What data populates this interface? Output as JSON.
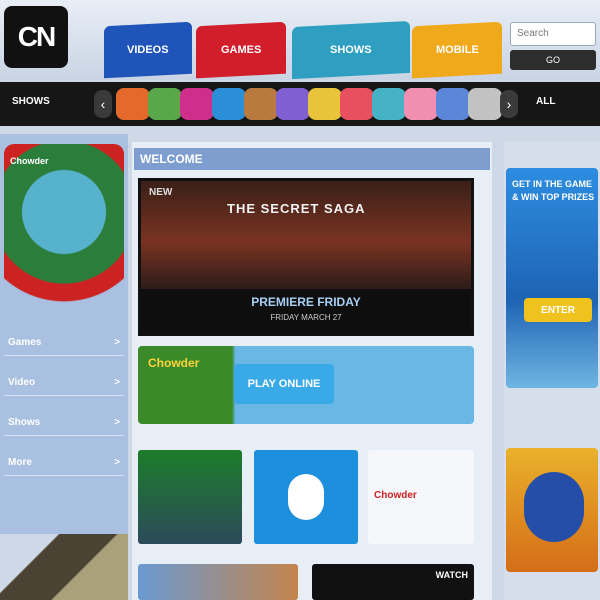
{
  "header": {
    "logo_text": "CN",
    "tabs": [
      "Videos",
      "Games",
      "Shows",
      "Mobile"
    ],
    "search_placeholder": "Search",
    "search_button": "GO"
  },
  "carousel": {
    "left_label": "Shows",
    "right_label": "All",
    "characters": [
      "#e46a2b",
      "#58a84a",
      "#cf2e8a",
      "#2b8fd8",
      "#b97a3f",
      "#7f5fd1",
      "#e9c43a",
      "#e84f5f",
      "#46b2c6",
      "#f08fb0",
      "#5c86d8",
      "#c2c2c2"
    ]
  },
  "sidebar": {
    "promo_label": "Chowder",
    "rows": [
      {
        "label": "Games",
        "meta": ">"
      },
      {
        "label": "Video",
        "meta": ">"
      },
      {
        "label": "Shows",
        "meta": ">"
      },
      {
        "label": "More",
        "meta": ">"
      }
    ]
  },
  "main": {
    "welcome_title": "Welcome",
    "hero": {
      "badge": "NEW",
      "title": "THE SECRET SAGA",
      "premiere": "PREMIERE FRIDAY",
      "time": "FRIDAY MARCH 27"
    },
    "banner": {
      "logo": "Chowder",
      "cta": "PLAY ONLINE"
    },
    "tile_c_text": "Chowder",
    "tile_bottom_text": "WATCH"
  },
  "right": {
    "ad_text": "GET IN THE GAME & WIN TOP PRIZES",
    "ad_button": "ENTER"
  }
}
